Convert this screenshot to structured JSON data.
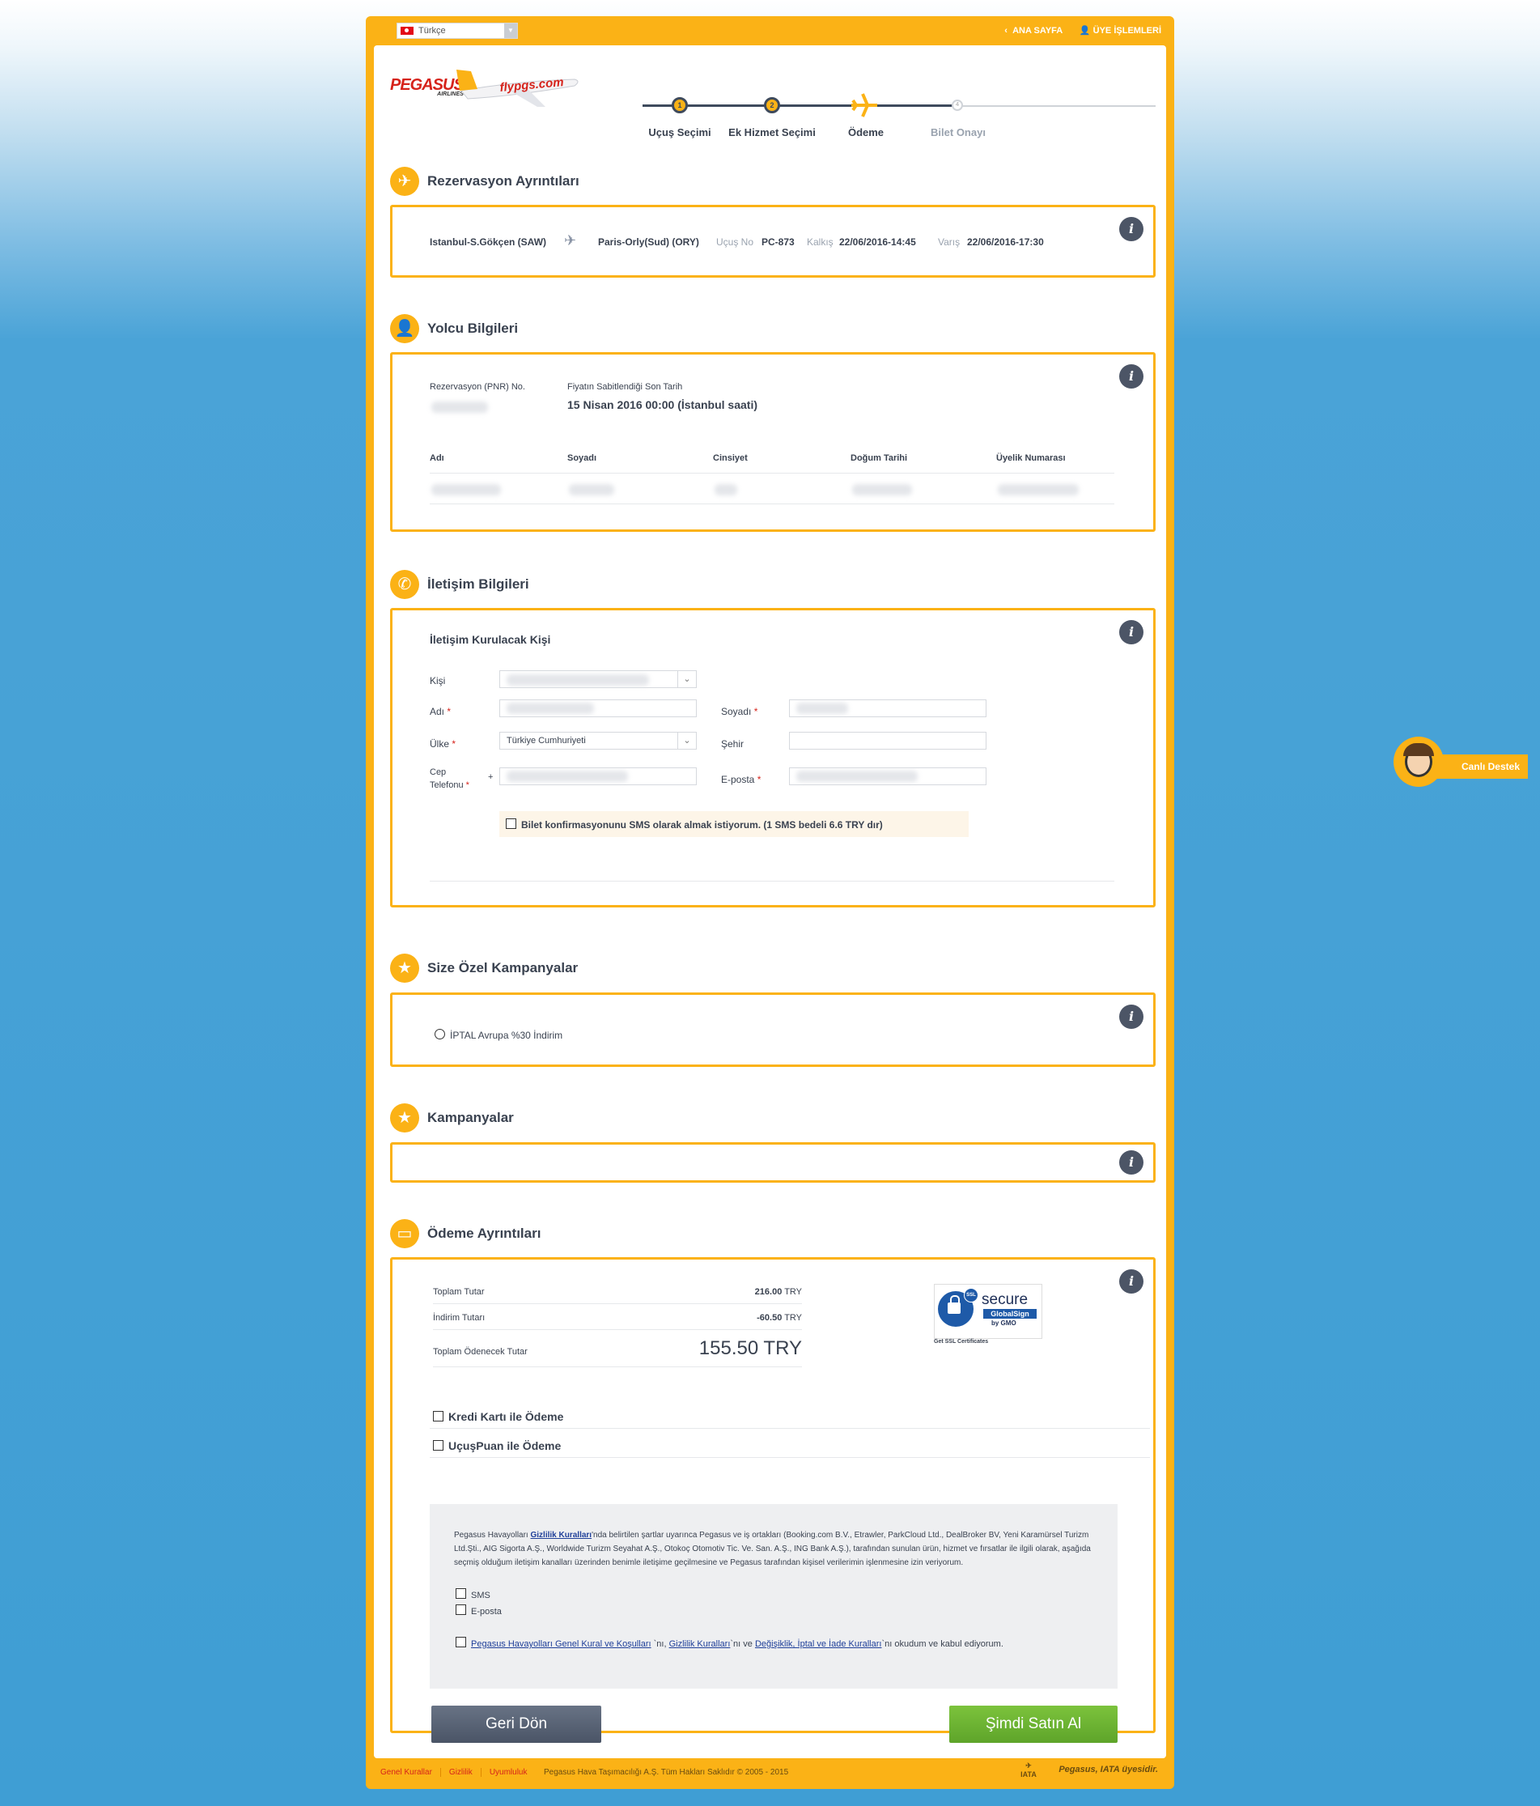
{
  "topbar": {
    "language": "Türkçe",
    "home": "ANA SAYFA",
    "member": "ÜYE İŞLEMLERİ"
  },
  "brand": {
    "logo": "PEGASUS",
    "logo_sub": "AIRLINES",
    "plane_text": "flypgs.com"
  },
  "steps": [
    {
      "num": "1",
      "label": "Uçuş Seçimi"
    },
    {
      "num": "2",
      "label": "Ek Hizmet Seçimi"
    },
    {
      "num": "",
      "label": "Ödeme"
    },
    {
      "num": "4",
      "label": "Bilet Onayı"
    }
  ],
  "reservation": {
    "title": "Rezervasyon Ayrıntıları",
    "from": "Istanbul-S.Gökçen (SAW)",
    "to": "Paris-Orly(Sud) (ORY)",
    "flight_label": "Uçuş No",
    "flight": "PC-873",
    "dep_label": "Kalkış",
    "dep": "22/06/2016-14:45",
    "arr_label": "Varış",
    "arr": "22/06/2016-17:30"
  },
  "passenger": {
    "title": "Yolcu Bilgileri",
    "pnr_label": "Rezervasyon (PNR) No.",
    "deadline_label": "Fiyatın Sabitlendiği Son Tarih",
    "deadline": "15 Nisan 2016 00:00 (İstanbul saati)",
    "columns": [
      "Adı",
      "Soyadı",
      "Cinsiyet",
      "Doğum Tarihi",
      "Üyelik Numarası"
    ]
  },
  "contact": {
    "title": "İletişim Bilgileri",
    "subtitle": "İletişim Kurulacak Kişi",
    "person": "Kişi",
    "name": "Adı",
    "surname": "Soyadı",
    "country": "Ülke",
    "country_value": "Türkiye Cumhuriyeti",
    "city": "Şehir",
    "phone_1": "Cep",
    "phone_2": "Telefonu",
    "phone_prefix": "+",
    "email": "E-posta",
    "sms_opt": "Bilet konfirmasyonunu SMS olarak almak istiyorum. (1 SMS bedeli 6.6 TRY dır)"
  },
  "special": {
    "title": "Size Özel Kampanyalar",
    "option": "İPTAL Avrupa %30 İndirim"
  },
  "campaigns": {
    "title": "Kampanyalar"
  },
  "payment": {
    "title": "Ödeme Ayrıntıları",
    "total_label": "Toplam Tutar",
    "total": "216.00",
    "discount_label": "İndirim Tutarı",
    "discount": "-60.50",
    "payable_label": "Toplam Ödenecek Tutar",
    "payable": "155.50 TRY",
    "currency": "TRY",
    "ssl_1": "secure",
    "ssl_2": "GlobalSign",
    "ssl_3": "by GMO",
    "ssl_caption": "Get SSL Certificates",
    "ssl_badge": "SSL",
    "opt_card": "Kredi Kartı ile Ödeme",
    "opt_points": "UçuşPuan ile Ödeme"
  },
  "consent": {
    "p1": "Pegasus Havayolları ",
    "p1_link": "Gizlilik Kuralları",
    "p1_rest": "'nda belirtilen şartlar uyarınca Pegasus ve iş ortakları (Booking.com B.V., Etrawler, ParkCloud Ltd., DealBroker BV, Yeni Karamürsel Turizm Ltd.Şti., AIG Sigorta A.Ş., Worldwide Turizm Seyahat A.Ş., Otokoç Otomotiv Tic. Ve. San. A.Ş., ING Bank A.Ş.), tarafından sunulan ürün, hizmet ve fırsatlar ile ilgili olarak, aşağıda seçmiş olduğum iletişim kanalları üzerinden benimle iletişime geçilmesine ve Pegasus tarafından kişisel verilerimin işlenmesine izin veriyorum.",
    "sms": "SMS",
    "email": "E-posta",
    "terms_link1": "Pegasus Havayolları Genel Kural ve Koşulları",
    "terms_t1": " `nı, ",
    "terms_link2": "Gizlilik Kuralları",
    "terms_t2": "`nı ve ",
    "terms_link3": "Değişiklik, İptal ve İade Kuralları",
    "terms_t3": "`nı okudum ve kabul ediyorum."
  },
  "buttons": {
    "back": "Geri Dön",
    "buy": "Şimdi Satın Al"
  },
  "support": "Canlı Destek",
  "footer": {
    "links": [
      "Genel Kurallar",
      "Gizlilik",
      "Uyumluluk"
    ],
    "copyright": "Pegasus Hava Taşımacılığı A.Ş. Tüm Hakları Saklıdır © 2005 - 2015",
    "iata": "Pegasus, IATA üyesidir.",
    "iata_logo": "IATA"
  },
  "colors": {
    "brand": "#fbb216",
    "dark": "#3e4a5c",
    "buy": "#6ab22e",
    "red": "#d6231b"
  }
}
